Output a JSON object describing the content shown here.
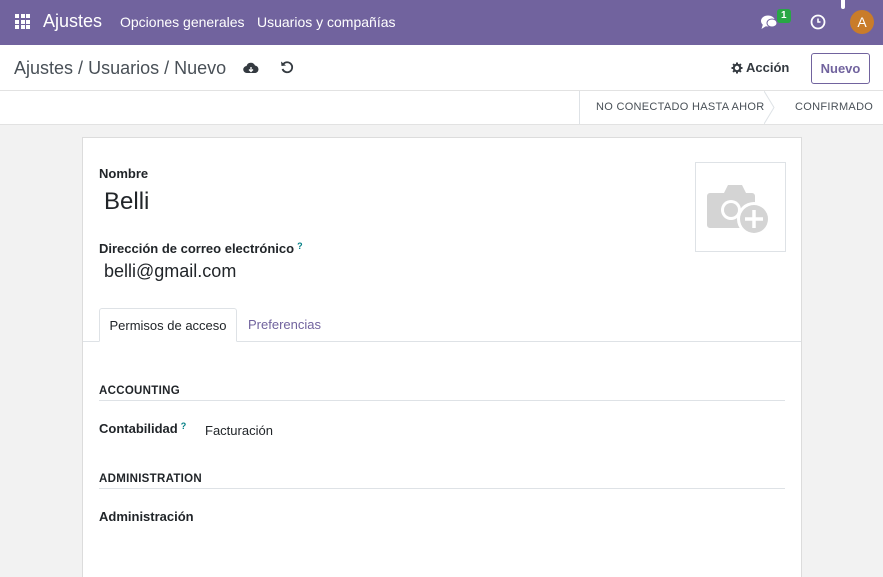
{
  "navbar": {
    "brand": "Ajustes",
    "menu": [
      "Opciones generales",
      "Usuarios y compañías"
    ],
    "chat_count": "1",
    "avatar_letter": "A",
    "color": "#71639e"
  },
  "control": {
    "breadcrumb": [
      "Ajustes",
      "/",
      "Usuarios",
      "/",
      "Nuevo"
    ],
    "action_label": "Acción",
    "new_label": "Nuevo"
  },
  "statusbar": {
    "stages": [
      "NO CONECTADO HASTA AHORA",
      "CONFIRMADO"
    ]
  },
  "form": {
    "name_label": "Nombre",
    "name_value": "Belli",
    "email_label": "Dirección de correo electrónico",
    "email_value": "belli@gmail.com",
    "help_mark": "?",
    "tabs": [
      "Permisos de acceso",
      "Preferencias"
    ],
    "sections": [
      {
        "title": "ACCOUNTING",
        "field_label": "Contabilidad",
        "field_value": "Facturación"
      },
      {
        "title": "ADMINISTRATION",
        "field_label": "Administración",
        "field_value": ""
      }
    ]
  }
}
